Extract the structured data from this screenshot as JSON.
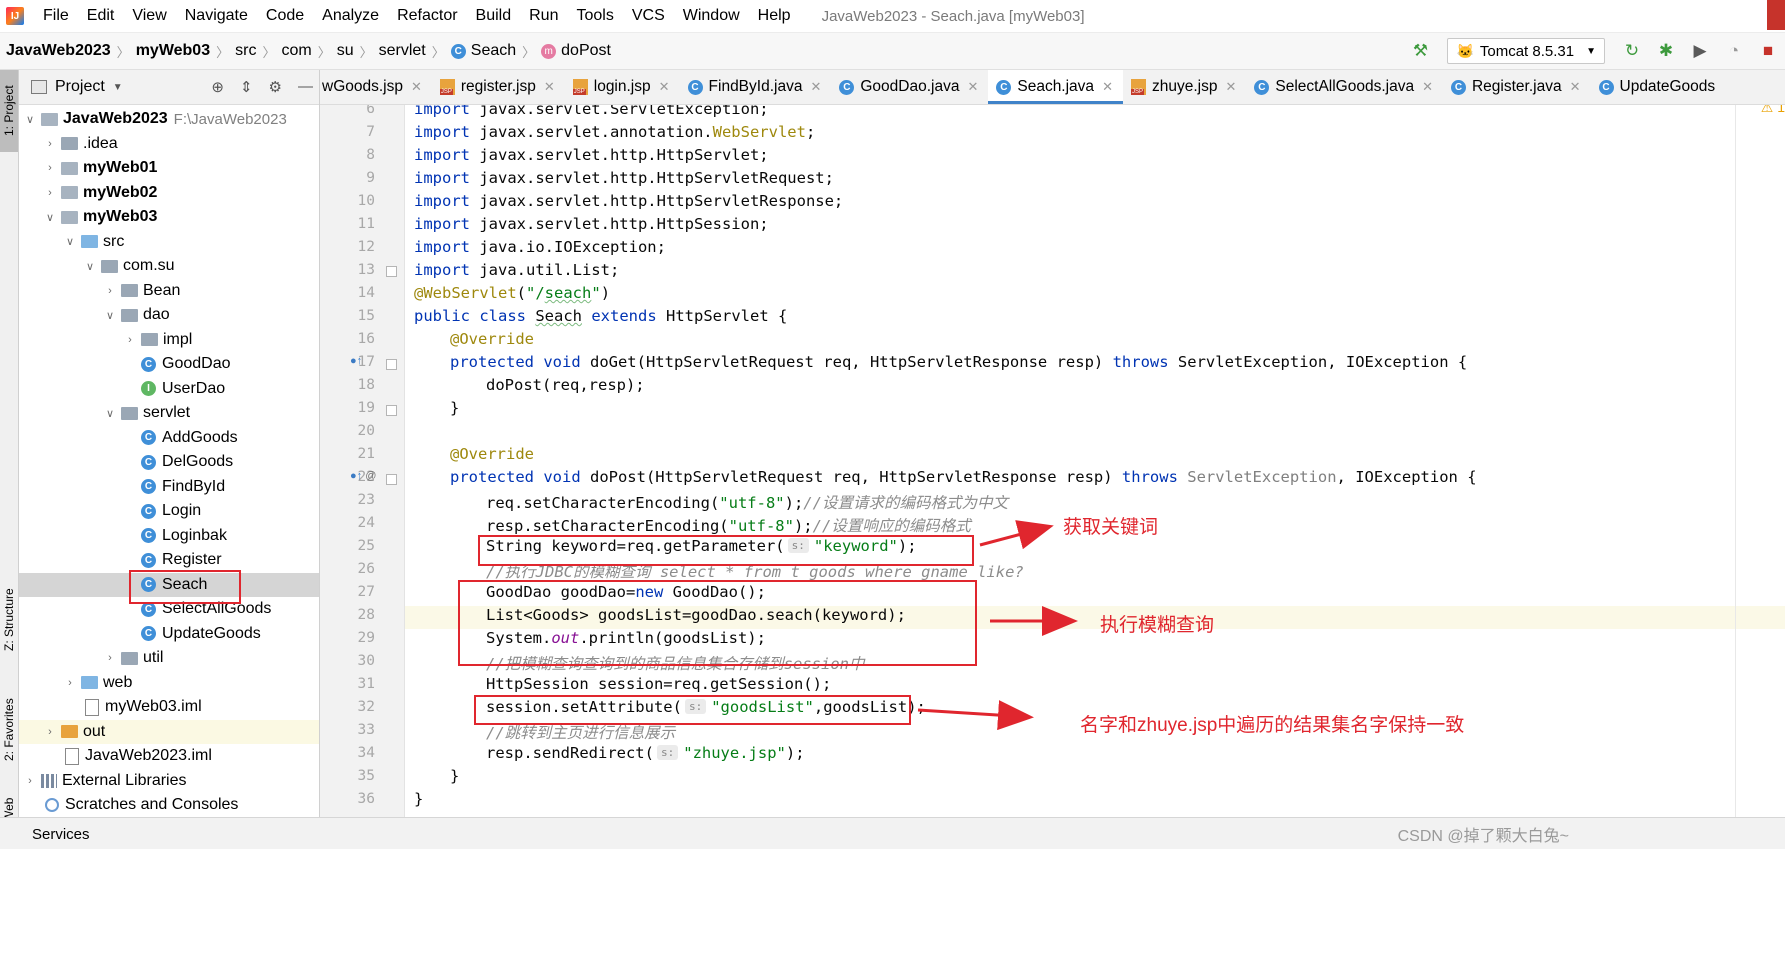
{
  "menu": {
    "items": [
      "File",
      "Edit",
      "View",
      "Navigate",
      "Code",
      "Analyze",
      "Refactor",
      "Build",
      "Run",
      "Tools",
      "VCS",
      "Window",
      "Help"
    ],
    "window_title": "JavaWeb2023 - Seach.java [myWeb03]"
  },
  "nav": {
    "crumbs": [
      "JavaWeb2023",
      "myWeb03",
      "src",
      "com",
      "su",
      "servlet",
      "Seach",
      "doPost"
    ],
    "run_config": "Tomcat 8.5.31"
  },
  "left_strip": {
    "project_tab": "1: Project",
    "structure_tab": "Z: Structure",
    "favorites_tab": "2: Favorites",
    "web_tab": "Web"
  },
  "project_panel": {
    "title": "Project",
    "tree": [
      {
        "label": "JavaWeb2023",
        "path": "F:\\JavaWeb2023"
      },
      {
        "label": ".idea"
      },
      {
        "label": "myWeb01"
      },
      {
        "label": "myWeb02"
      },
      {
        "label": "myWeb03"
      },
      {
        "label": "src"
      },
      {
        "label": "com.su"
      },
      {
        "label": "Bean"
      },
      {
        "label": "dao"
      },
      {
        "label": "impl"
      },
      {
        "label": "GoodDao"
      },
      {
        "label": "UserDao"
      },
      {
        "label": "servlet"
      },
      {
        "label": "AddGoods"
      },
      {
        "label": "DelGoods"
      },
      {
        "label": "FindById"
      },
      {
        "label": "Login"
      },
      {
        "label": "Loginbak"
      },
      {
        "label": "Register"
      },
      {
        "label": "Seach"
      },
      {
        "label": "SelectAllGoods"
      },
      {
        "label": "UpdateGoods"
      },
      {
        "label": "util"
      },
      {
        "label": "web"
      },
      {
        "label": "myWeb03.iml"
      },
      {
        "label": "out"
      },
      {
        "label": "JavaWeb2023.iml"
      },
      {
        "label": "External Libraries"
      },
      {
        "label": "Scratches and Consoles"
      }
    ]
  },
  "tabs": [
    "wGoods.jsp",
    "register.jsp",
    "login.jsp",
    "FindById.java",
    "GoodDao.java",
    "Seach.java",
    "zhuye.jsp",
    "SelectAllGoods.java",
    "Register.java",
    "UpdateGoods"
  ],
  "editor": {
    "line_numbers": [
      "6",
      "7",
      "8",
      "9",
      "10",
      "11",
      "12",
      "13",
      "14",
      "15",
      "16",
      "17",
      "18",
      "19",
      "20",
      "21",
      "22",
      "23",
      "24",
      "25",
      "26",
      "27",
      "28",
      "29",
      "30",
      "31",
      "32",
      "33",
      "34",
      "35",
      "36"
    ],
    "warning_count": "1",
    "code": {
      "l6a": "import ",
      "l6b": "javax.servlet.ServletException;",
      "l7a": "import ",
      "l7b": "javax.servlet.annotation.",
      "l7c": "WebServlet",
      ";": ";",
      "l8a": "import ",
      "l8b": "javax.servlet.http.HttpServlet;",
      "l9a": "import ",
      "l9b": "javax.servlet.http.HttpServletRequest;",
      "l10a": "import ",
      "l10b": "javax.servlet.http.HttpServletResponse;",
      "l11a": "import ",
      "l11b": "javax.servlet.http.HttpSession;",
      "l12a": "import ",
      "l12b": "java.io.IOException;",
      "l13a": "import ",
      "l13b": "java.util.List;",
      "l14a": "@WebServlet",
      "l14b": "(",
      "l14c": "\"/",
      "l14d": "seach",
      "l14e": "\"",
      ")": ")",
      "l15a": "public class ",
      "l15b": "Seach",
      "l15c": " extends ",
      "l15d": "HttpServlet {",
      "l16": "@Override",
      "l17a": "protected void ",
      "l17b": "doGet(HttpServletRequest req, HttpServletResponse resp) ",
      "l17c": "throws ",
      "l17d": "ServletException, IOException {",
      "l18": "doPost(req,resp);",
      "l19": "}",
      "l21": "@Override",
      "l22a": "protected void ",
      "l22b": "doPost(HttpServletRequest req, HttpServletResponse resp) ",
      "l22c": "throws ",
      "l22d": "ServletException",
      ", IOException {": ", IOException {",
      "l23a": "req.setCharacterEncoding(",
      "l23b": "\"utf-8\"",
      "l23c": ");",
      "l23d": "//设置请求的编码格式为中文",
      "l24a": "resp.setCharacterEncoding(",
      "l24b": "\"utf-8\"",
      "l24c": ");",
      "l24d": "//设置响应的编码格式",
      "l25a": "String keyword=req.getParameter(",
      "l25hint": "s:",
      "l25b": "\"keyword\"",
      "l25c": ");",
      "l26": "//执行JDBC的模糊查询 select * from t_goods where gname like?",
      "l27a": "GoodDao goodDao=",
      "l27b": "new ",
      "l27c": "GoodDao();",
      "l28": "List<Goods> goodsList=goodDao.seach(keyword);",
      "l29a": "System.",
      "l29b": "out",
      "l29c": ".println(goodsList);",
      "l30": "//把模糊查询查询到的商品信息集合存储到session中",
      "l31": "HttpSession session=req.getSession();",
      "l32a": "session.setAttribute(",
      "l32hint": "s:",
      "l32b": "\"goodsList\"",
      "l32c": ",goodsList);",
      "l33": "//跳转到主页进行信息展示",
      "l34a": "resp.sendRedirect(",
      "l34hint": "s:",
      "l34b": "\"zhuye.jsp\"",
      "l34c": ");",
      "l35": "}",
      "l36": "}"
    }
  },
  "annotations": {
    "a1": "获取关键词",
    "a2": "执行模糊查询",
    "a3": "名字和zhuye.jsp中遍历的结果集名字保持一致",
    "color": "#e0262e"
  },
  "bottom": {
    "services": "Services",
    "watermark": "CSDN @掉了颗大白兔~"
  }
}
